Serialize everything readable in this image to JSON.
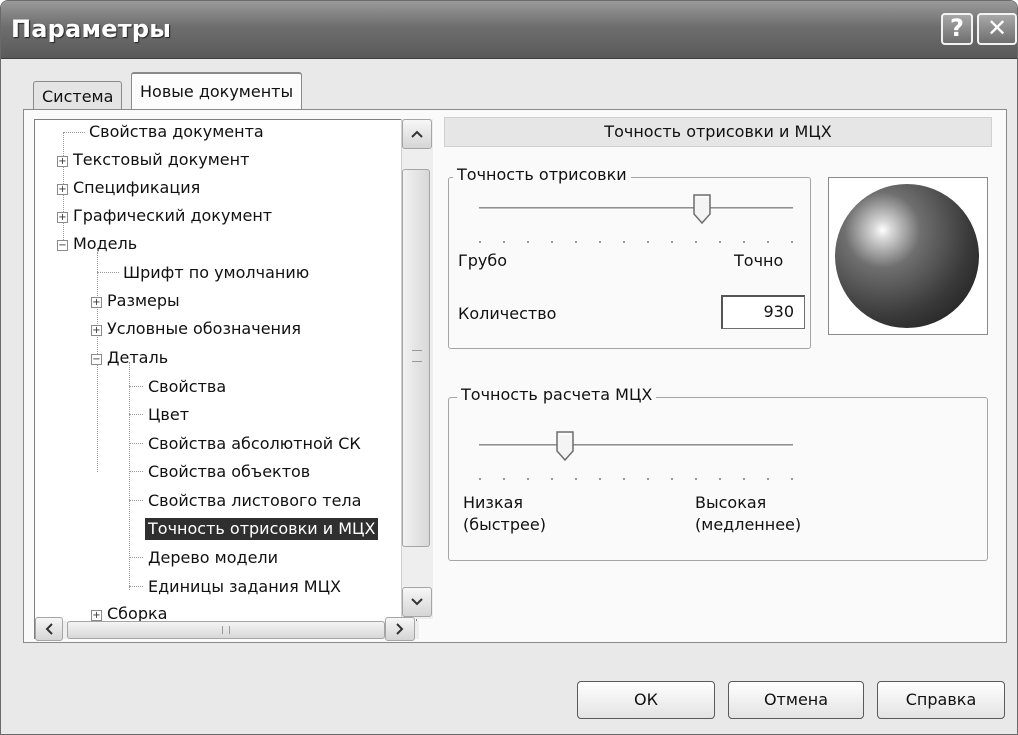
{
  "window": {
    "title": "Параметры",
    "help_label": "?",
    "close_label": "✕"
  },
  "tabs": [
    {
      "label": "Система",
      "active": false
    },
    {
      "label": "Новые документы",
      "active": true
    }
  ],
  "tree": {
    "items": [
      {
        "label": "Свойства документа",
        "expander": ""
      },
      {
        "label": "Текстовый документ",
        "expander": "+"
      },
      {
        "label": "Спецификация",
        "expander": "+"
      },
      {
        "label": "Графический документ",
        "expander": "+"
      },
      {
        "label": "Модель",
        "expander": "−"
      },
      {
        "label": "Шрифт по умолчанию",
        "expander": ""
      },
      {
        "label": "Размеры",
        "expander": "+"
      },
      {
        "label": "Условные обозначения",
        "expander": "+"
      },
      {
        "label": "Деталь",
        "expander": "−"
      },
      {
        "label": "Свойства",
        "expander": ""
      },
      {
        "label": "Цвет",
        "expander": ""
      },
      {
        "label": "Свойства абсолютной СК",
        "expander": ""
      },
      {
        "label": "Свойства объектов",
        "expander": ""
      },
      {
        "label": "Свойства листового тела",
        "expander": ""
      },
      {
        "label": "Точность отрисовки и МЦХ",
        "expander": "",
        "selected": true
      },
      {
        "label": "Дерево модели",
        "expander": ""
      },
      {
        "label": "Единицы задания МЦХ",
        "expander": ""
      },
      {
        "label": "Сборка",
        "expander": "+"
      }
    ]
  },
  "content": {
    "header": "Точность отрисовки и МЦХ",
    "render_precision": {
      "group_label": "Точность отрисовки",
      "min_label": "Грубо",
      "max_label": "Точно",
      "slider_level": 0.72,
      "count_label": "Количество",
      "count_value": "930"
    },
    "mch_precision": {
      "group_label": "Точность расчета МЦХ",
      "min_label_1": "Низкая",
      "min_label_2": "(быстрее)",
      "max_label_1": "Высокая",
      "max_label_2": "(медленнее)",
      "slider_level": 0.27
    }
  },
  "buttons": {
    "ok": "ОК",
    "cancel": "Отмена",
    "help": "Справка"
  }
}
